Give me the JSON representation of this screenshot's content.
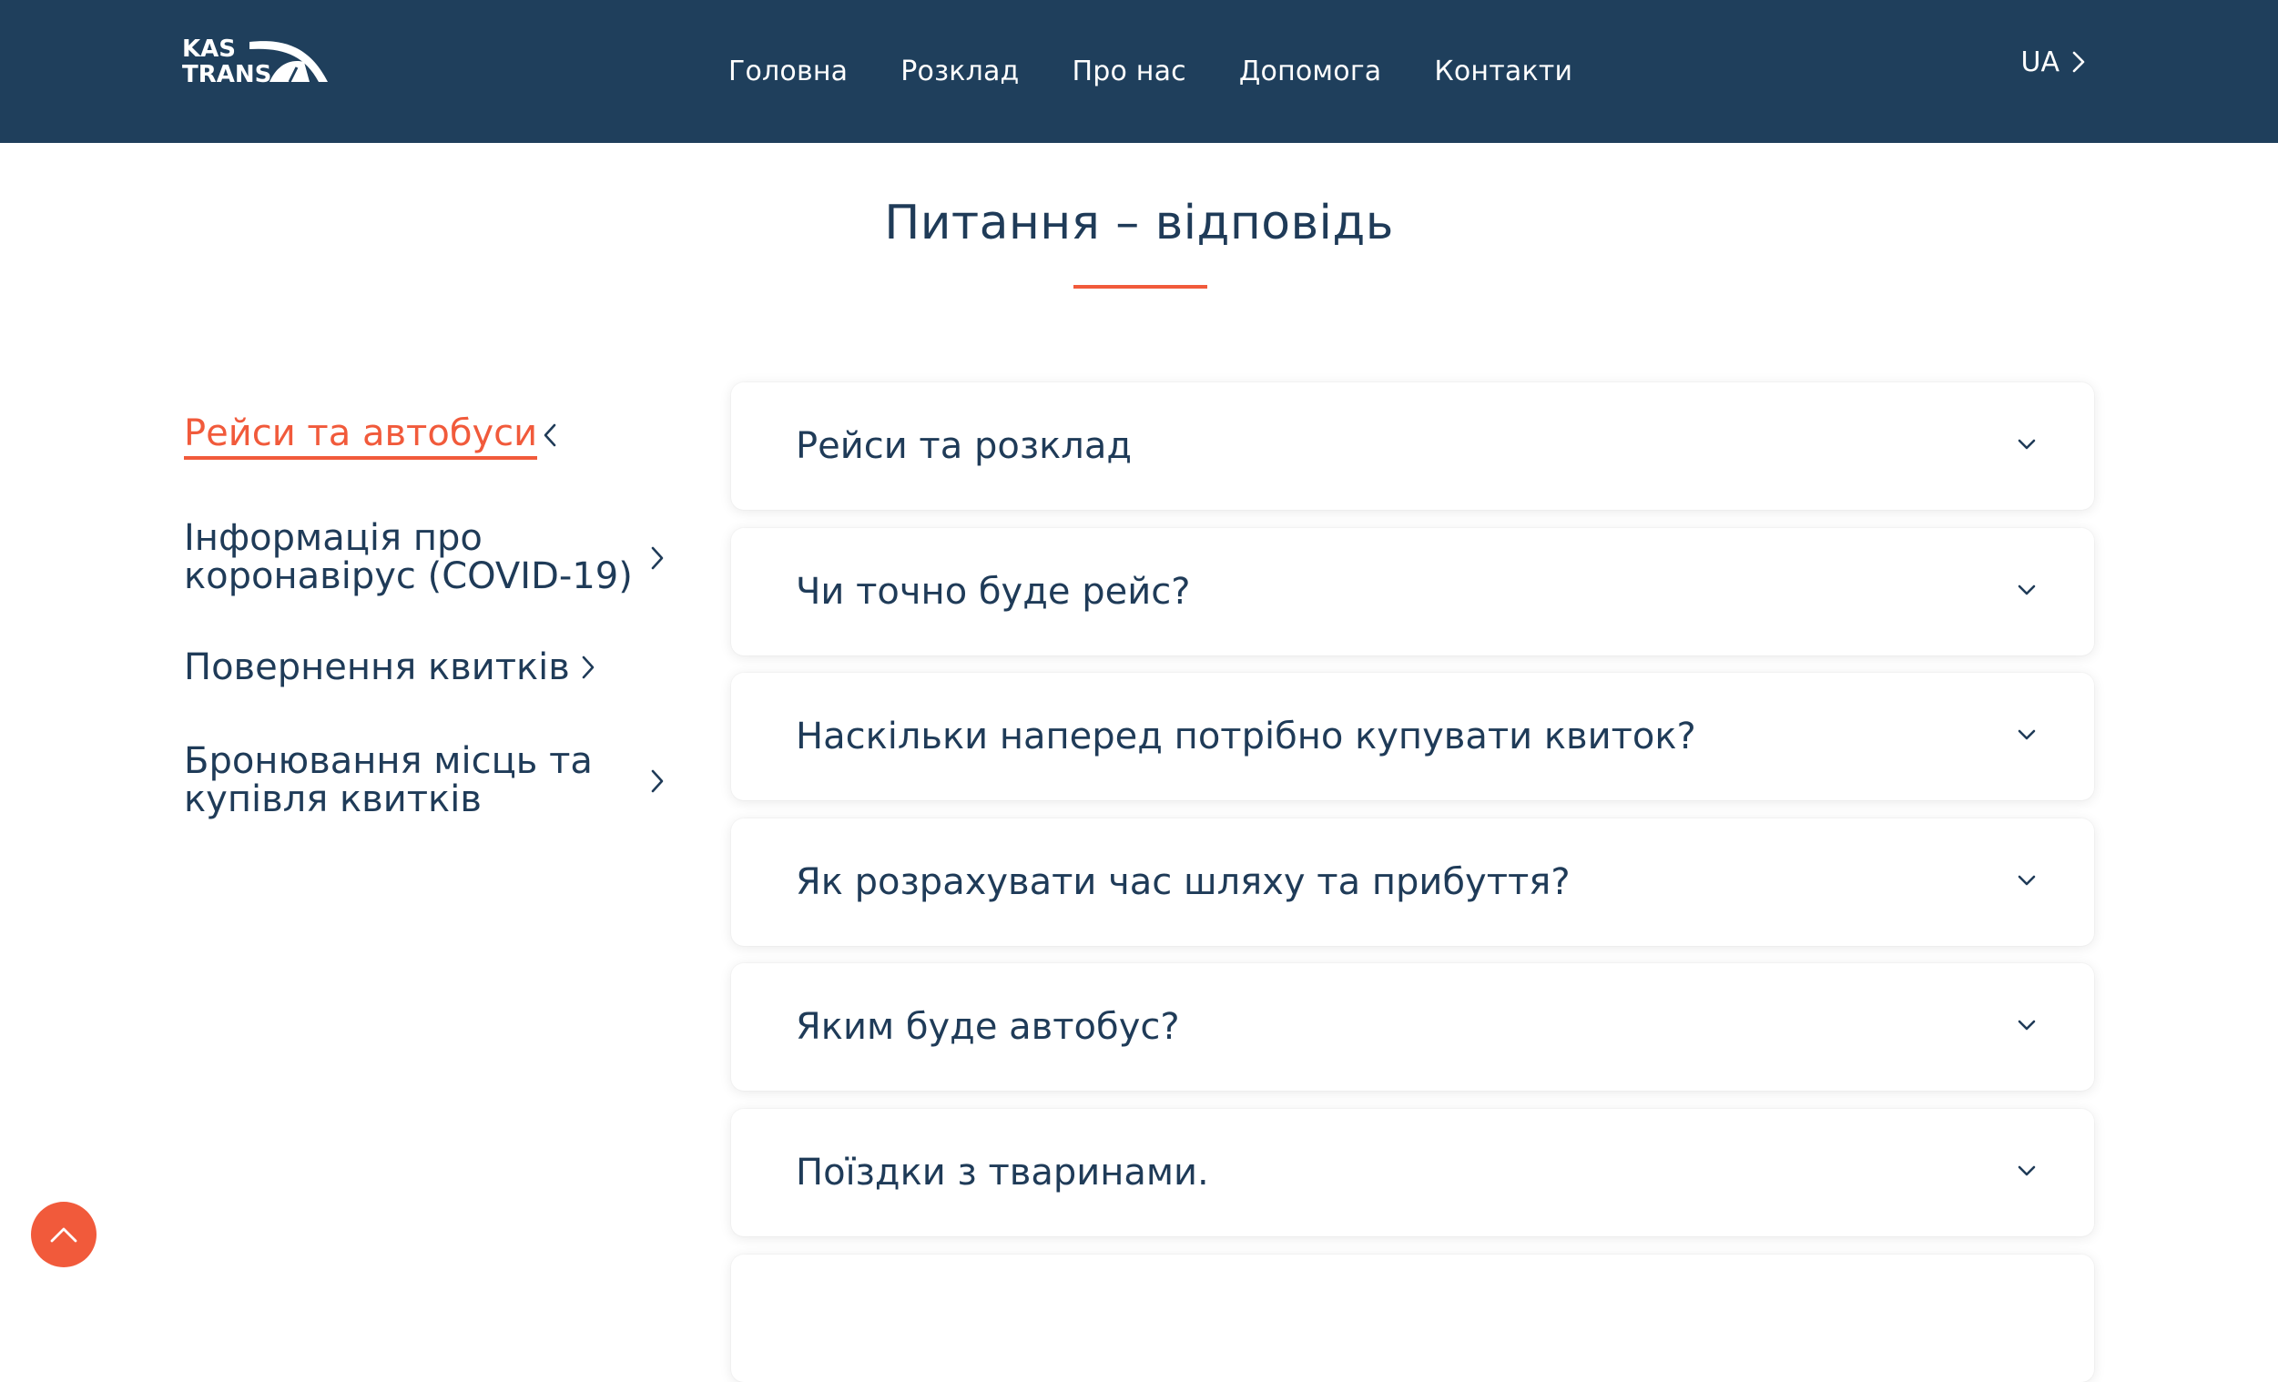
{
  "header": {
    "logo_text_line1": "KAS",
    "logo_text_line2": "TRANS",
    "nav": [
      {
        "label": "Головна"
      },
      {
        "label": "Розклад"
      },
      {
        "label": "Про нас"
      },
      {
        "label": "Допомога"
      },
      {
        "label": "Контакти"
      }
    ],
    "language": "UA"
  },
  "page": {
    "title": "Питання – відповідь"
  },
  "sidebar": {
    "items": [
      {
        "label": "Рейси та автобуси",
        "active": true
      },
      {
        "label_line1": "Інформація про",
        "label_line2": "коронавірус (COVID-19)"
      },
      {
        "label": "Повернення квитків"
      },
      {
        "label_line1": "Бронювання місць та",
        "label_line2": "купівля квитків"
      }
    ]
  },
  "faq": {
    "items": [
      {
        "question": "Рейси та розклад"
      },
      {
        "question": "Чи точно буде рейс?"
      },
      {
        "question": "Наскільки наперед потрібно купувати квиток?"
      },
      {
        "question": "Як розрахувати час шляху та прибуття?"
      },
      {
        "question": "Яким буде автобус?"
      },
      {
        "question": "Поїздки з тваринами."
      }
    ]
  },
  "colors": {
    "header_bg": "#1f3f5c",
    "text_primary": "#1f3b58",
    "accent": "#f15a3b",
    "page_bg": "#ffffff"
  },
  "icons": {
    "logo": "kastrans-logo",
    "language_chevron": "chevron-right-icon",
    "faq_toggle": "chevron-down-icon",
    "sidebar_active": "chevron-left-icon",
    "sidebar_inactive": "chevron-right-icon",
    "scroll_top": "chevron-up-icon"
  }
}
